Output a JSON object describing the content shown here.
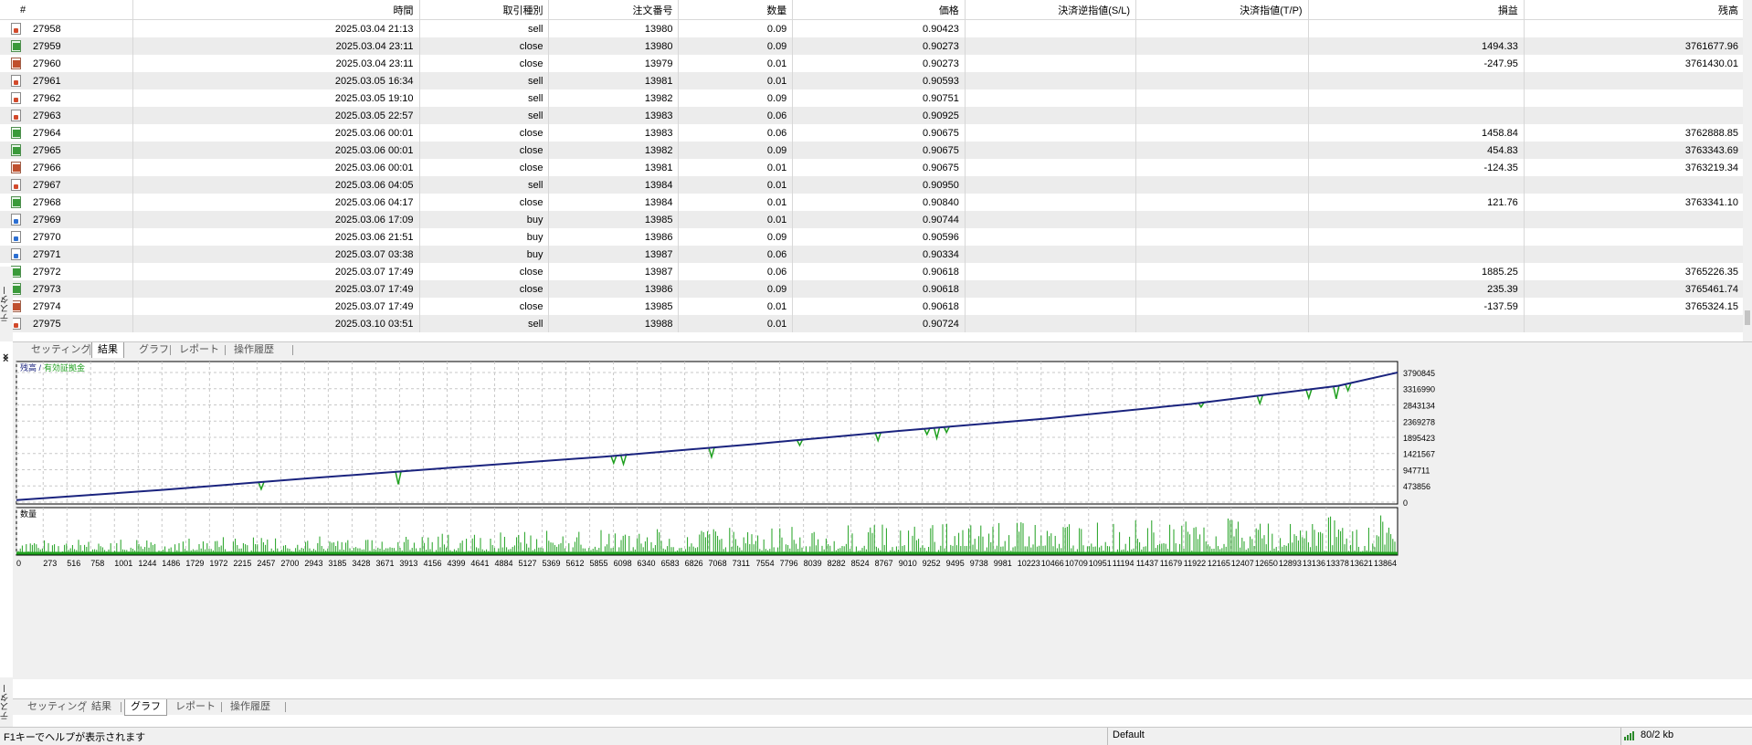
{
  "table": {
    "columns": [
      "#",
      "時間",
      "取引種別",
      "注文番号",
      "数量",
      "価格",
      "決済逆指値(S/L)",
      "決済指値(T/P)",
      "損益",
      "残高"
    ],
    "rows": [
      {
        "id": "27958",
        "time": "2025.03.04 21:13",
        "type": "sell",
        "order": "13980",
        "volume": "0.09",
        "price": "0.90423",
        "sl": "",
        "tp": "",
        "profit": "",
        "balance": "",
        "icon": "sell"
      },
      {
        "id": "27959",
        "time": "2025.03.04 23:11",
        "type": "close",
        "order": "13980",
        "volume": "0.09",
        "price": "0.90273",
        "sl": "",
        "tp": "",
        "profit": "1494.33",
        "balance": "3761677.96",
        "icon": "close-plus"
      },
      {
        "id": "27960",
        "time": "2025.03.04 23:11",
        "type": "close",
        "order": "13979",
        "volume": "0.01",
        "price": "0.90273",
        "sl": "",
        "tp": "",
        "profit": "-247.95",
        "balance": "3761430.01",
        "icon": "close-minus"
      },
      {
        "id": "27961",
        "time": "2025.03.05 16:34",
        "type": "sell",
        "order": "13981",
        "volume": "0.01",
        "price": "0.90593",
        "sl": "",
        "tp": "",
        "profit": "",
        "balance": "",
        "icon": "sell"
      },
      {
        "id": "27962",
        "time": "2025.03.05 19:10",
        "type": "sell",
        "order": "13982",
        "volume": "0.09",
        "price": "0.90751",
        "sl": "",
        "tp": "",
        "profit": "",
        "balance": "",
        "icon": "sell"
      },
      {
        "id": "27963",
        "time": "2025.03.05 22:57",
        "type": "sell",
        "order": "13983",
        "volume": "0.06",
        "price": "0.90925",
        "sl": "",
        "tp": "",
        "profit": "",
        "balance": "",
        "icon": "sell"
      },
      {
        "id": "27964",
        "time": "2025.03.06 00:01",
        "type": "close",
        "order": "13983",
        "volume": "0.06",
        "price": "0.90675",
        "sl": "",
        "tp": "",
        "profit": "1458.84",
        "balance": "3762888.85",
        "icon": "close-plus"
      },
      {
        "id": "27965",
        "time": "2025.03.06 00:01",
        "type": "close",
        "order": "13982",
        "volume": "0.09",
        "price": "0.90675",
        "sl": "",
        "tp": "",
        "profit": "454.83",
        "balance": "3763343.69",
        "icon": "close-plus"
      },
      {
        "id": "27966",
        "time": "2025.03.06 00:01",
        "type": "close",
        "order": "13981",
        "volume": "0.01",
        "price": "0.90675",
        "sl": "",
        "tp": "",
        "profit": "-124.35",
        "balance": "3763219.34",
        "icon": "close-minus"
      },
      {
        "id": "27967",
        "time": "2025.03.06 04:05",
        "type": "sell",
        "order": "13984",
        "volume": "0.01",
        "price": "0.90950",
        "sl": "",
        "tp": "",
        "profit": "",
        "balance": "",
        "icon": "sell"
      },
      {
        "id": "27968",
        "time": "2025.03.06 04:17",
        "type": "close",
        "order": "13984",
        "volume": "0.01",
        "price": "0.90840",
        "sl": "",
        "tp": "",
        "profit": "121.76",
        "balance": "3763341.10",
        "icon": "close-plus"
      },
      {
        "id": "27969",
        "time": "2025.03.06 17:09",
        "type": "buy",
        "order": "13985",
        "volume": "0.01",
        "price": "0.90744",
        "sl": "",
        "tp": "",
        "profit": "",
        "balance": "",
        "icon": "buy"
      },
      {
        "id": "27970",
        "time": "2025.03.06 21:51",
        "type": "buy",
        "order": "13986",
        "volume": "0.09",
        "price": "0.90596",
        "sl": "",
        "tp": "",
        "profit": "",
        "balance": "",
        "icon": "buy"
      },
      {
        "id": "27971",
        "time": "2025.03.07 03:38",
        "type": "buy",
        "order": "13987",
        "volume": "0.06",
        "price": "0.90334",
        "sl": "",
        "tp": "",
        "profit": "",
        "balance": "",
        "icon": "buy"
      },
      {
        "id": "27972",
        "time": "2025.03.07 17:49",
        "type": "close",
        "order": "13987",
        "volume": "0.06",
        "price": "0.90618",
        "sl": "",
        "tp": "",
        "profit": "1885.25",
        "balance": "3765226.35",
        "icon": "close-plus"
      },
      {
        "id": "27973",
        "time": "2025.03.07 17:49",
        "type": "close",
        "order": "13986",
        "volume": "0.09",
        "price": "0.90618",
        "sl": "",
        "tp": "",
        "profit": "235.39",
        "balance": "3765461.74",
        "icon": "close-plus"
      },
      {
        "id": "27974",
        "time": "2025.03.07 17:49",
        "type": "close",
        "order": "13985",
        "volume": "0.01",
        "price": "0.90618",
        "sl": "",
        "tp": "",
        "profit": "-137.59",
        "balance": "3765324.15",
        "icon": "close-minus"
      },
      {
        "id": "27975",
        "time": "2025.03.10 03:51",
        "type": "sell",
        "order": "13988",
        "volume": "0.01",
        "price": "0.90724",
        "sl": "",
        "tp": "",
        "profit": "",
        "balance": "",
        "icon": "sell"
      }
    ]
  },
  "side_label": "テスター",
  "tabs_top": [
    "セッティング",
    "結果",
    "グラフ",
    "レポート",
    "操作履歴"
  ],
  "tabs_top_active": 1,
  "tabs_bottom": [
    "セッティング",
    "結果",
    "グラフ",
    "レポート",
    "操作履歴"
  ],
  "tabs_bottom_active": 2,
  "close_icon": "×",
  "status": {
    "help": "F1キーでヘルプが表示されます",
    "profile": "Default",
    "traffic": "80/2 kb",
    "traffic_icon": "traffic-bars-icon"
  },
  "colors": {
    "balance_line": "#1a237e",
    "equity_line": "#1fa01f",
    "volume_bars": "#1fa01f",
    "chart_bg": "#ffffff",
    "grid": "#c8c8c8"
  },
  "chart_data": [
    {
      "type": "line",
      "legend": [
        "残高",
        "有効証拠金"
      ],
      "y_ticks": [
        0,
        473856,
        947711,
        1421567,
        1895423,
        2369278,
        2843134,
        3316990,
        3790845
      ],
      "ylim": [
        0,
        3790845
      ],
      "x_ticks": [
        0,
        273,
        516,
        758,
        1001,
        1244,
        1486,
        1729,
        1972,
        2215,
        2457,
        2700,
        2943,
        3185,
        3428,
        3671,
        3913,
        4156,
        4399,
        4641,
        4884,
        5127,
        5369,
        5612,
        5855,
        6098,
        6340,
        6583,
        6826,
        7068,
        7311,
        7554,
        7796,
        8039,
        8282,
        8524,
        8767,
        9010,
        9252,
        9495,
        9738,
        9981,
        10223,
        10466,
        10709,
        10951,
        11194,
        11437,
        11679,
        11922,
        12165,
        12407,
        12650,
        12893,
        13136,
        13378,
        13621,
        13864
      ],
      "xlim": [
        0,
        14107
      ],
      "grid": true,
      "series": [
        {
          "name": "残高",
          "x": [
            0,
            1500,
            3000,
            4500,
            6000,
            7500,
            9000,
            10500,
            12000,
            13500,
            14107
          ],
          "values": [
            60000,
            360000,
            700000,
            1020000,
            1330000,
            1690000,
            2080000,
            2440000,
            2870000,
            3400000,
            3790845
          ]
        },
        {
          "name": "有効証拠金",
          "x": [
            2500,
            3900,
            6100,
            6200,
            7100,
            8000,
            8800,
            9300,
            9400,
            9500,
            12100,
            12700,
            13200,
            13480,
            13600
          ],
          "values": [
            380000,
            520000,
            1140000,
            1110000,
            1320000,
            1660000,
            1800000,
            1980000,
            1870000,
            2040000,
            2780000,
            2880000,
            3040000,
            3020000,
            3260000
          ]
        }
      ]
    },
    {
      "type": "bar",
      "title": "数量",
      "description_values_note": "",
      "x": [
        0,
        14107
      ],
      "values": []
    }
  ]
}
